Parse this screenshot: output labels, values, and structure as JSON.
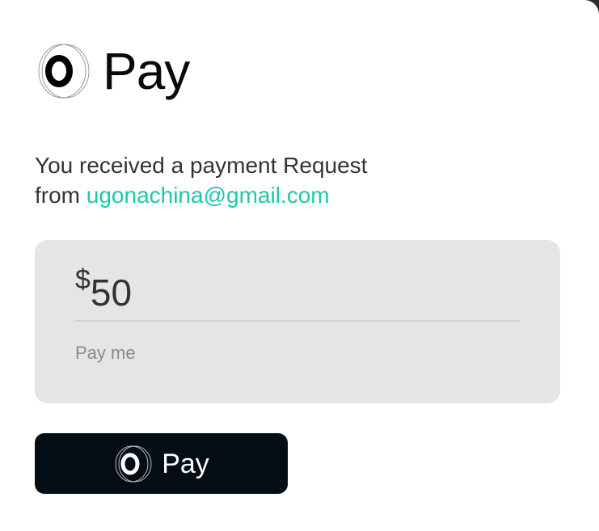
{
  "brand": {
    "name": "Pay",
    "logo_icon": "ring-logo-icon"
  },
  "message": {
    "line1": "You received a payment Request",
    "from_prefix": "from ",
    "email": "ugonachina@gmail.com"
  },
  "payment": {
    "currency_symbol": "$",
    "amount": "50",
    "note": "Pay me"
  },
  "button": {
    "label": "Pay",
    "icon": "ring-logo-icon"
  },
  "colors": {
    "accent": "#1ec9a8",
    "button_bg": "#040d14",
    "panel_bg": "#e5e5e5",
    "text": "#333333",
    "muted": "#8a8a8a"
  }
}
